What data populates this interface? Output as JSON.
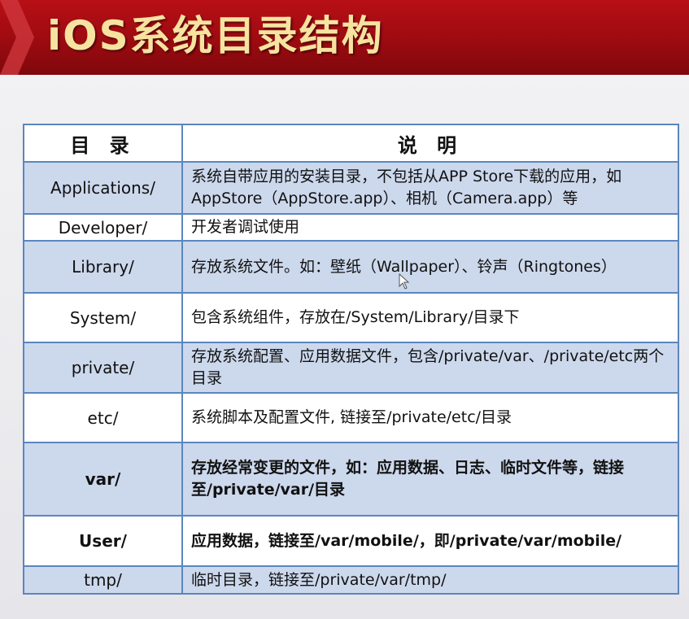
{
  "title": "iOS系统目录结构",
  "table": {
    "headers": {
      "dir": "目 录",
      "desc": "说 明"
    },
    "rows": [
      {
        "dir": "Applications/",
        "desc": "系统自带应用的安装目录，不包括从APP Store下载的应用，如 AppStore（AppStore.app）、相机（Camera.app）等",
        "shade": "blue",
        "bold": false
      },
      {
        "dir": "Developer/",
        "desc": "开发者调试使用",
        "shade": "white",
        "bold": false
      },
      {
        "dir": "Library/",
        "desc": "存放系统文件。如：壁纸（Wallpaper）、铃声（Ringtones）",
        "shade": "blue",
        "bold": false
      },
      {
        "dir": "System/",
        "desc": "包含系统组件，存放在/System/Library/目录下",
        "shade": "white",
        "bold": false
      },
      {
        "dir": "private/",
        "desc": "存放系统配置、应用数据文件，包含/private/var、/private/etc两个目录",
        "shade": "blue",
        "bold": false
      },
      {
        "dir": "etc/",
        "desc": "系统脚本及配置文件, 链接至/private/etc/目录",
        "shade": "white",
        "bold": false
      },
      {
        "dir": "var/",
        "desc": "存放经常变更的文件，如：应用数据、日志、临时文件等，链接至/private/var/目录",
        "shade": "blue",
        "bold": true
      },
      {
        "dir": "User/",
        "desc": "应用数据，链接至/var/mobile/，即/private/var/mobile/",
        "shade": "white",
        "bold": true
      },
      {
        "dir": "tmp/",
        "desc": "临时目录，链接至/private/var/tmp/",
        "shade": "blue",
        "bold": false
      }
    ]
  },
  "colors": {
    "banner": "#9c0b10",
    "title_text": "#f6e3a0",
    "row_blue": "#ccd8ec",
    "border": "#5b86bf"
  }
}
